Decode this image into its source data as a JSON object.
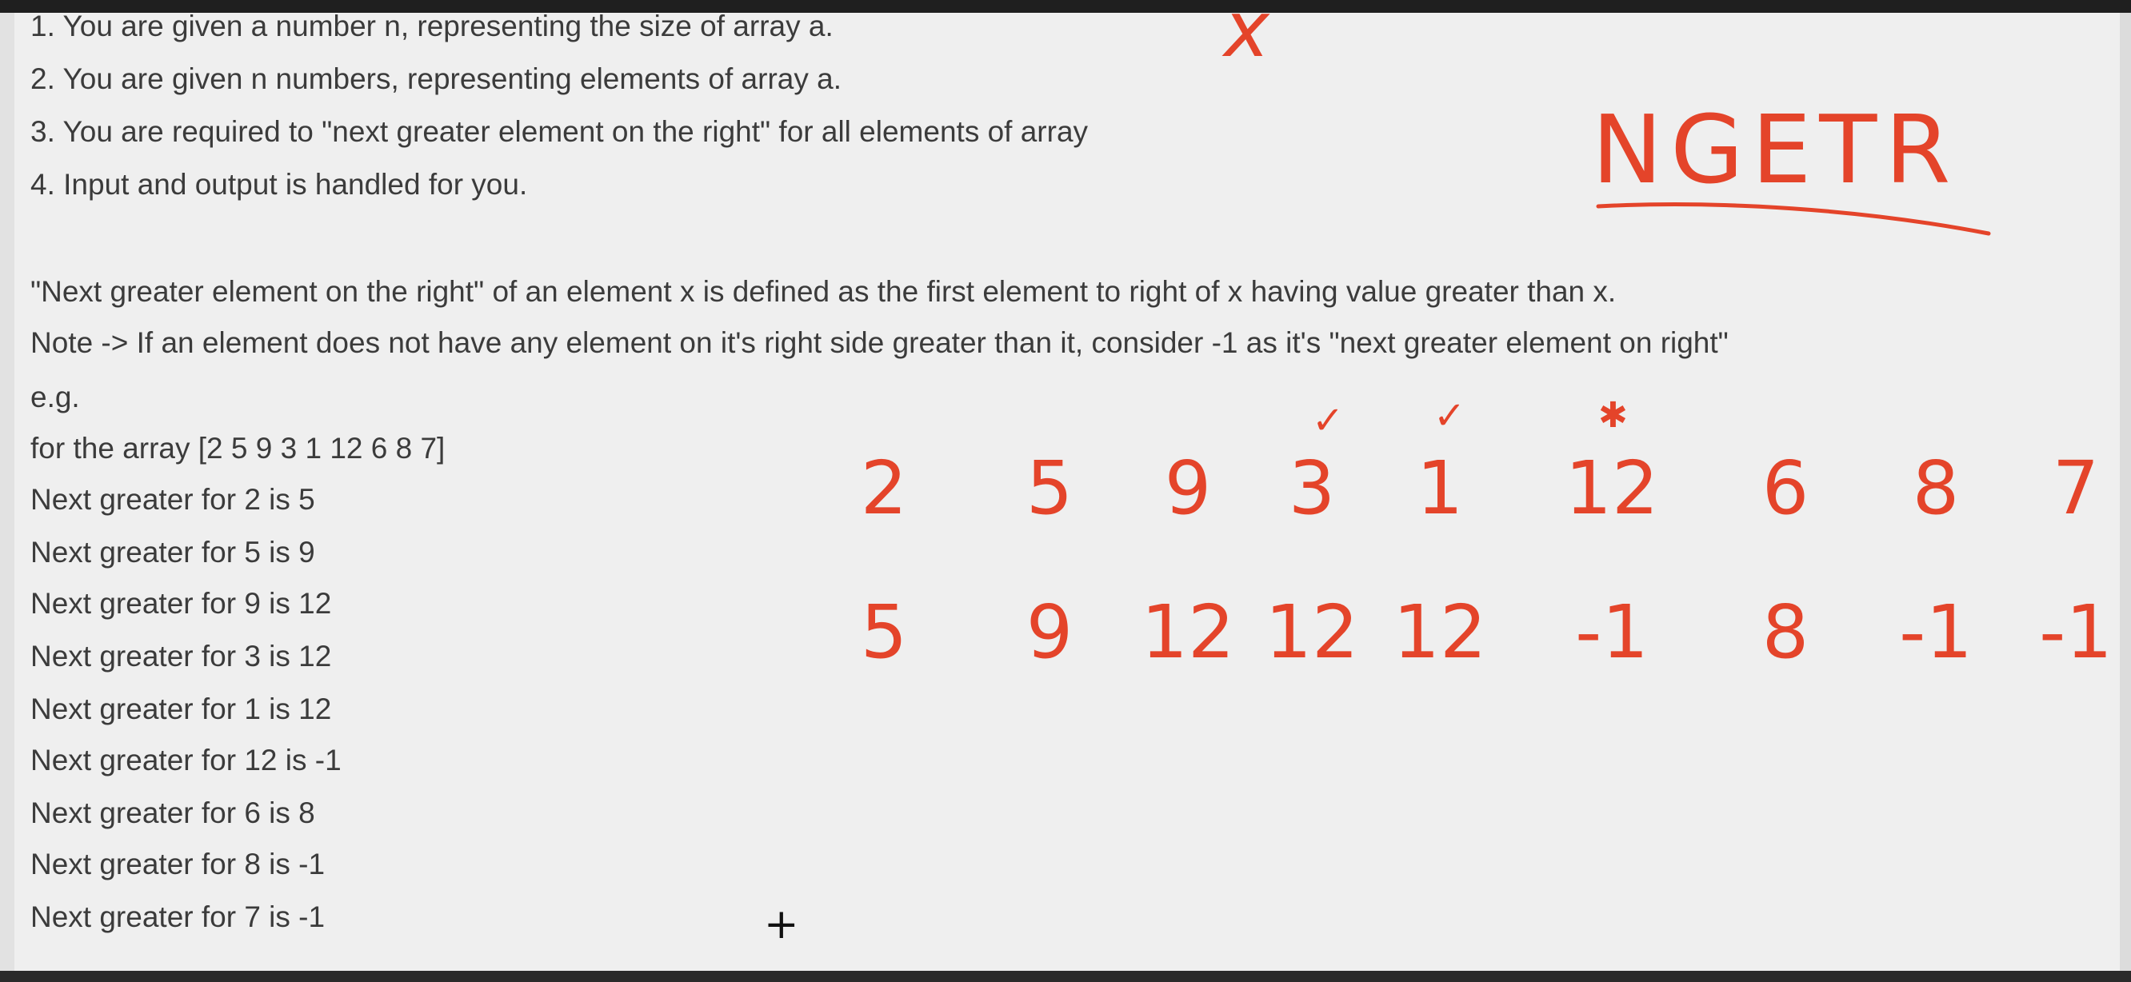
{
  "problem": {
    "steps": [
      "1. You are given a number n, representing the size of array a.",
      "2. You are given n numbers, representing elements of array a.",
      "3. You are required to \"next greater element on the right\" for all elements of array",
      "4. Input and output is handled for you."
    ],
    "definition": "\"Next greater element on the right\" of an element x is defined as the first element to right of x having value greater than x.",
    "note": "Note -> If an element does not have any element on it's right side greater than it, consider -1 as it's \"next greater element on right\"",
    "eg_label": "e.g.",
    "array_line": "for the array [2 5 9 3 1 12 6 8 7]",
    "results": [
      "Next greater for 2 is 5",
      "Next greater for 5 is 9",
      "Next greater for 9 is 12",
      "Next greater for 3 is 12",
      "Next greater for 1 is 12",
      "Next greater for 12 is -1",
      "Next greater for 6 is 8",
      "Next greater for 8 is -1",
      "Next greater for 7 is -1"
    ]
  },
  "annotations": {
    "ink_color": "#e4442a",
    "x_mark": "x",
    "acronym": "NGETR",
    "input_row": [
      "2",
      "5",
      "9",
      "3",
      "1",
      "12",
      "6",
      "8",
      "7"
    ],
    "output_row": [
      "5",
      "9",
      "12",
      "12",
      "12",
      "-1",
      "8",
      "-1",
      "-1"
    ],
    "tick_marks": [
      "✓",
      "✓"
    ],
    "star_mark": "✱"
  },
  "cursor": {
    "symbol": "+"
  }
}
